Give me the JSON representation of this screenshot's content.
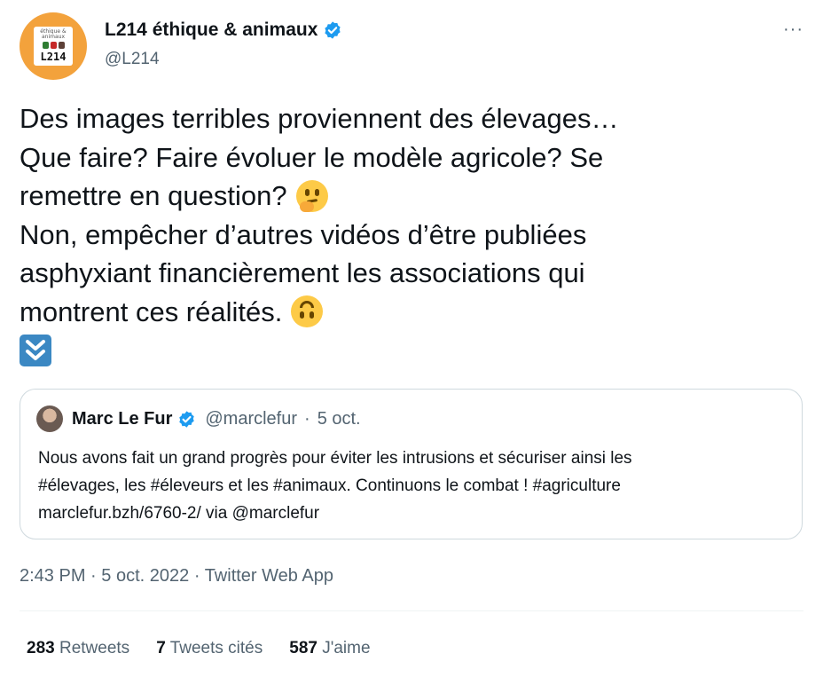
{
  "author": {
    "name": "L214 éthique & animaux",
    "handle": "@L214",
    "avatar_text_small": "éthique & animaux",
    "avatar_text": "L214",
    "verified": true
  },
  "tweet": {
    "lines": [
      "Des images terribles proviennent des élevages…",
      "Que faire? Faire évoluer le modèle agricole? Se",
      "remettre en question?",
      "Non, empêcher d’autres vidéos d’être publiées",
      "asphyxiant financièrement les associations qui",
      "montrent ces réalités."
    ],
    "emojis": [
      "thinking-face",
      "upside-down-face",
      "down-double-arrow"
    ]
  },
  "quoted": {
    "name": "Marc Le Fur",
    "handle": "@marclefur",
    "separator": "·",
    "date": "5 oct.",
    "verified": true,
    "lines": [
      "Nous avons fait un grand progrès pour éviter les intrusions et sécuriser ainsi les",
      "#élevages, les #éleveurs et les #animaux. Continuons le combat ! #agriculture",
      "marclefur.bzh/6760-2/ via @marclefur"
    ]
  },
  "meta": {
    "time": "2:43 PM",
    "sep1": "·",
    "date": "5 oct. 2022",
    "sep2": "·",
    "source": "Twitter Web App"
  },
  "stats": {
    "retweets_count": "283",
    "retweets_label": "Retweets",
    "quotes_count": "7",
    "quotes_label": "Tweets cités",
    "likes_count": "587",
    "likes_label": "J'aime"
  },
  "more_label": "···",
  "colors": {
    "text": "#0f1419",
    "secondary": "#536471",
    "verified": "#1d9bf0",
    "border": "#cfd9de",
    "avatar_bg": "#f3a23c"
  }
}
